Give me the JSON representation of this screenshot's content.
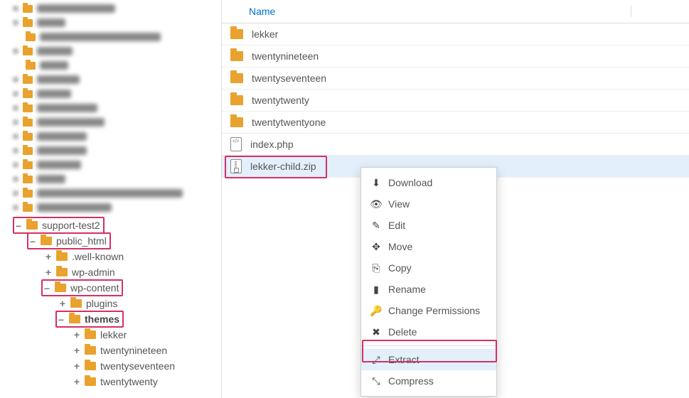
{
  "columns": {
    "name": "Name"
  },
  "tree": {
    "support_test2": "support-test2",
    "public_html": "public_html",
    "well_known": ".well-known",
    "wp_admin": "wp-admin",
    "wp_content": "wp-content",
    "plugins": "plugins",
    "themes": "themes",
    "lekker": "lekker",
    "twentynineteen": "twentynineteen",
    "twentyseventeen": "twentyseventeen",
    "twentytwenty": "twentytwenty"
  },
  "files": [
    {
      "name": "lekker",
      "type": "folder"
    },
    {
      "name": "twentynineteen",
      "type": "folder"
    },
    {
      "name": "twentyseventeen",
      "type": "folder"
    },
    {
      "name": "twentytwenty",
      "type": "folder"
    },
    {
      "name": "twentytwentyone",
      "type": "folder"
    },
    {
      "name": "index.php",
      "type": "code"
    },
    {
      "name": "lekker-child.zip",
      "type": "zip",
      "selected": true
    }
  ],
  "context_menu": {
    "download": "Download",
    "view": "View",
    "edit": "Edit",
    "move": "Move",
    "copy": "Copy",
    "rename": "Rename",
    "permissions": "Change Permissions",
    "delete": "Delete",
    "extract": "Extract",
    "compress": "Compress"
  }
}
